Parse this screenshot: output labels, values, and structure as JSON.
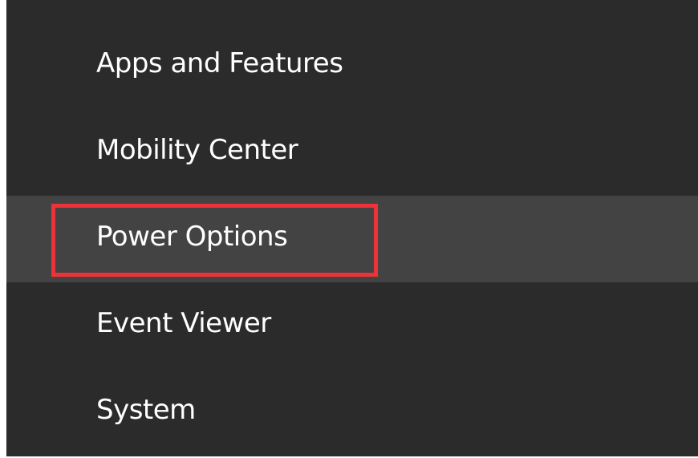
{
  "context_menu": {
    "items": [
      {
        "label": "Apps and Features",
        "state": "normal"
      },
      {
        "label": "Mobility Center",
        "state": "normal"
      },
      {
        "label": "Power Options",
        "state": "hovered"
      },
      {
        "label": "Event Viewer",
        "state": "normal"
      },
      {
        "label": "System",
        "state": "normal"
      }
    ],
    "highlighted_item": "Power Options"
  },
  "colors": {
    "menu_background": "#2b2b2b",
    "hover_background": "#434343",
    "text": "#ffffff",
    "highlight_border": "#ed3338"
  }
}
